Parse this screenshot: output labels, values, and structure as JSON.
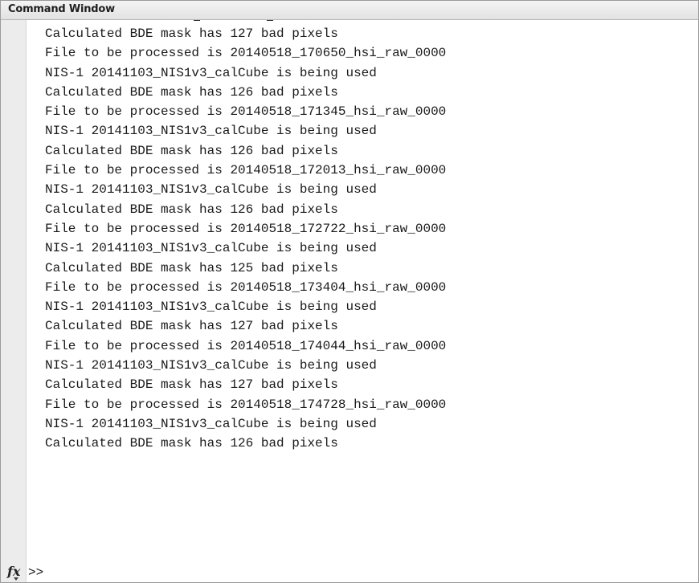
{
  "window": {
    "title": "Command Window"
  },
  "output_lines": [
    "Calculated BDE mask has 127 bad pixels",
    "File to be processed is 20140518_170650_hsi_raw_0000",
    "NIS-1 20141103_NIS1v3_calCube is being used",
    "Calculated BDE mask has 126 bad pixels",
    "File to be processed is 20140518_171345_hsi_raw_0000",
    "NIS-1 20141103_NIS1v3_calCube is being used",
    "Calculated BDE mask has 126 bad pixels",
    "File to be processed is 20140518_172013_hsi_raw_0000",
    "NIS-1 20141103_NIS1v3_calCube is being used",
    "Calculated BDE mask has 126 bad pixels",
    "File to be processed is 20140518_172722_hsi_raw_0000",
    "NIS-1 20141103_NIS1v3_calCube is being used",
    "Calculated BDE mask has 125 bad pixels",
    "File to be processed is 20140518_173404_hsi_raw_0000",
    "NIS-1 20141103_NIS1v3_calCube is being used",
    "Calculated BDE mask has 127 bad pixels",
    "File to be processed is 20140518_174044_hsi_raw_0000",
    "NIS-1 20141103_NIS1v3_calCube is being used",
    "Calculated BDE mask has 127 bad pixels",
    "File to be processed is 20140518_174728_hsi_raw_0000",
    "NIS-1 20141103_NIS1v3_calCube is being used",
    "Calculated BDE mask has 126 bad pixels"
  ],
  "prompt": {
    "symbol": ">>",
    "function_browser_icon": "fx-icon",
    "input_value": ""
  }
}
